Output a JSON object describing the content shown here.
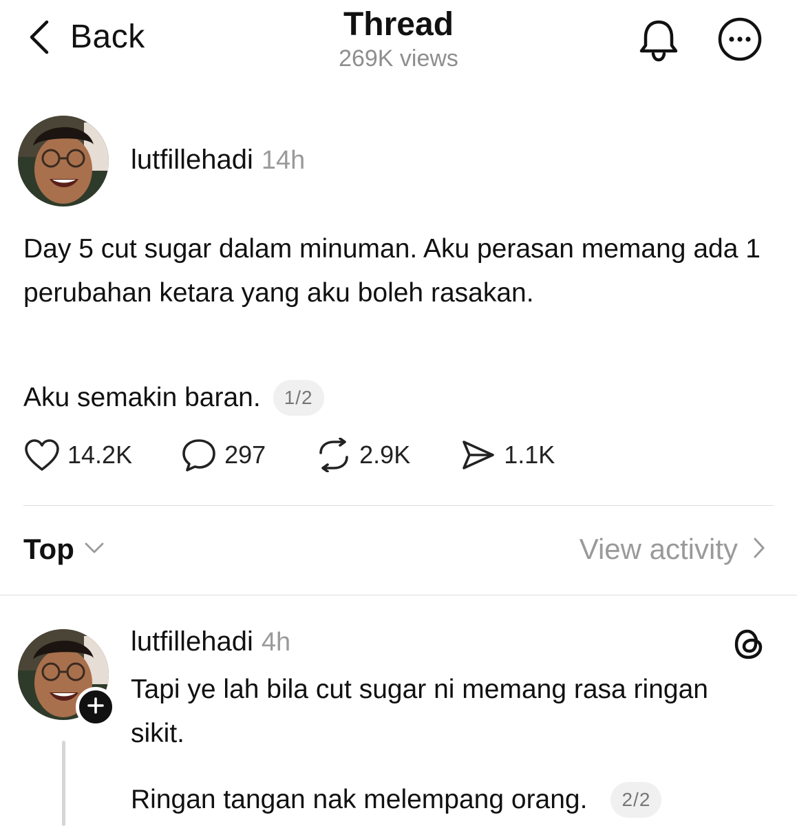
{
  "header": {
    "back_label": "Back",
    "title": "Thread",
    "views": "269K views",
    "icons": [
      "chevron-left-icon",
      "bell-icon",
      "more-icon"
    ]
  },
  "post": {
    "username": "lutfillehadi",
    "time": "14h",
    "body": "Day 5 cut sugar dalam minuman. Aku perasan memang ada 1 perubahan ketara yang aku boleh rasakan.",
    "tail": "Aku semakin baran.",
    "pager": "1/2",
    "stats": {
      "likes": "14.2K",
      "comments": "297",
      "reposts": "2.9K",
      "shares": "1.1K"
    }
  },
  "sort": {
    "label": "Top",
    "view_activity": "View activity"
  },
  "reply": {
    "username": "lutfillehadi",
    "time": "4h",
    "body": "Tapi ye lah bila cut sugar ni memang rasa ringan sikit.",
    "tail": "Ringan tangan nak melempang orang.",
    "pager": "2/2"
  },
  "colors": {
    "text": "#111111",
    "muted": "#8e8e8e",
    "divider": "#dcdcdc",
    "pager_bg": "#f0f0f0"
  }
}
